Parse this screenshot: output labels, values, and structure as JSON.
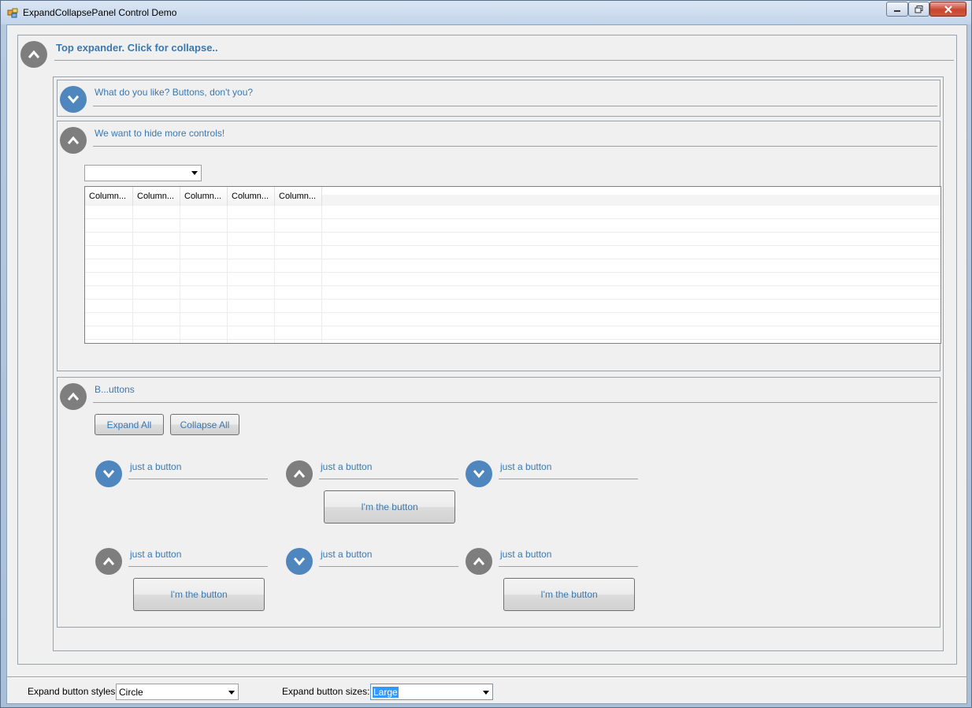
{
  "window": {
    "title": "ExpandCollapsePanel Control Demo"
  },
  "top_expander": {
    "title": "Top expander. Click for collapse..",
    "state": "expanded"
  },
  "panel_buttons_question": {
    "title": "What do you like? Buttons, don't you?",
    "state": "collapsed"
  },
  "panel_hide_controls": {
    "title": "We want to hide more controls!",
    "state": "expanded",
    "combo_value": "",
    "grid_columns": [
      "Column...",
      "Column...",
      "Column...",
      "Column...",
      "Column..."
    ]
  },
  "panel_buttons": {
    "title": "B...uttons",
    "state": "expanded",
    "expand_all_label": "Expand All",
    "collapse_all_label": "Collapse All",
    "mini_panels": [
      {
        "title": "just a button",
        "state": "collapsed",
        "button_label": ""
      },
      {
        "title": "just a button",
        "state": "expanded",
        "button_label": "I'm the button"
      },
      {
        "title": "just a button",
        "state": "collapsed",
        "button_label": ""
      },
      {
        "title": "just a button",
        "state": "expanded",
        "button_label": "I'm the button"
      },
      {
        "title": "just a button",
        "state": "collapsed",
        "button_label": ""
      },
      {
        "title": "just a button",
        "state": "expanded",
        "button_label": "I'm the button"
      }
    ]
  },
  "footer": {
    "style_label": "Expand button styles:",
    "style_value": "Circle",
    "size_label": "Expand button sizes:",
    "size_value": "Large"
  },
  "colors": {
    "accent_text": "#3a78b0",
    "circle_expanded": "#7e7e7e",
    "circle_collapsed": "#4f86bd",
    "selection": "#3399ff"
  },
  "icons": {
    "expanded": "chevron-up-icon",
    "collapsed": "chevron-down-icon"
  }
}
